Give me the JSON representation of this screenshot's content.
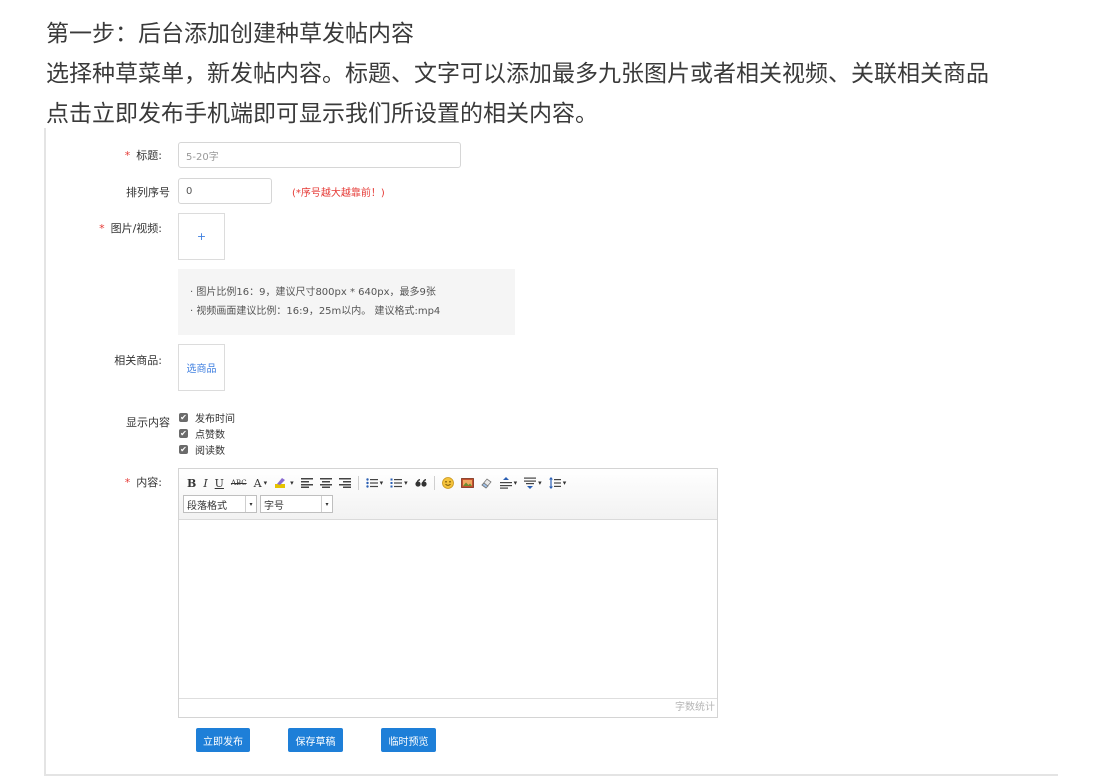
{
  "intro": {
    "line1": "第一步：后台添加创建种草发帖内容",
    "line2": "选择种草菜单，新发帖内容。标题、文字可以添加最多九张图片或者相关视频、关联相关商品",
    "line3": "点击立即发布手机端即可显示我们所设置的相关内容。"
  },
  "form": {
    "required_mark": "*",
    "title": {
      "label": "标题:",
      "placeholder": "5-20字"
    },
    "sort": {
      "label": "排列序号",
      "value": "0",
      "hint": "(*序号越大越靠前！)"
    },
    "media": {
      "label": "图片/视频:",
      "upload_symbol": "+",
      "tips": [
        "· 图片比例16：9，建议尺寸800px * 640px，最多9张",
        "· 视频画面建议比例：16:9，25m以内。 建议格式:mp4"
      ]
    },
    "goods": {
      "label": "相关商品:",
      "button": "选商品"
    },
    "display": {
      "label": "显示内容",
      "options": [
        {
          "label": "发布时间",
          "checked": true
        },
        {
          "label": "点赞数",
          "checked": true
        },
        {
          "label": "阅读数",
          "checked": true
        }
      ],
      "check_glyph": "✔"
    },
    "content": {
      "label": "内容:",
      "toolbar": {
        "bold": "B",
        "italic": "I",
        "underline": "U",
        "strike": "ABC",
        "font_color": "A",
        "caret": "▾",
        "paragraph_format": "段落格式",
        "font_size": "字号"
      },
      "word_count": "字数统计"
    }
  },
  "actions": {
    "publish": "立即发布",
    "save_draft": "保存草稿",
    "preview": "临时预览"
  },
  "colors": {
    "accent": "#1e7fd8",
    "required": "#e53935",
    "link": "#3f7fe0"
  }
}
